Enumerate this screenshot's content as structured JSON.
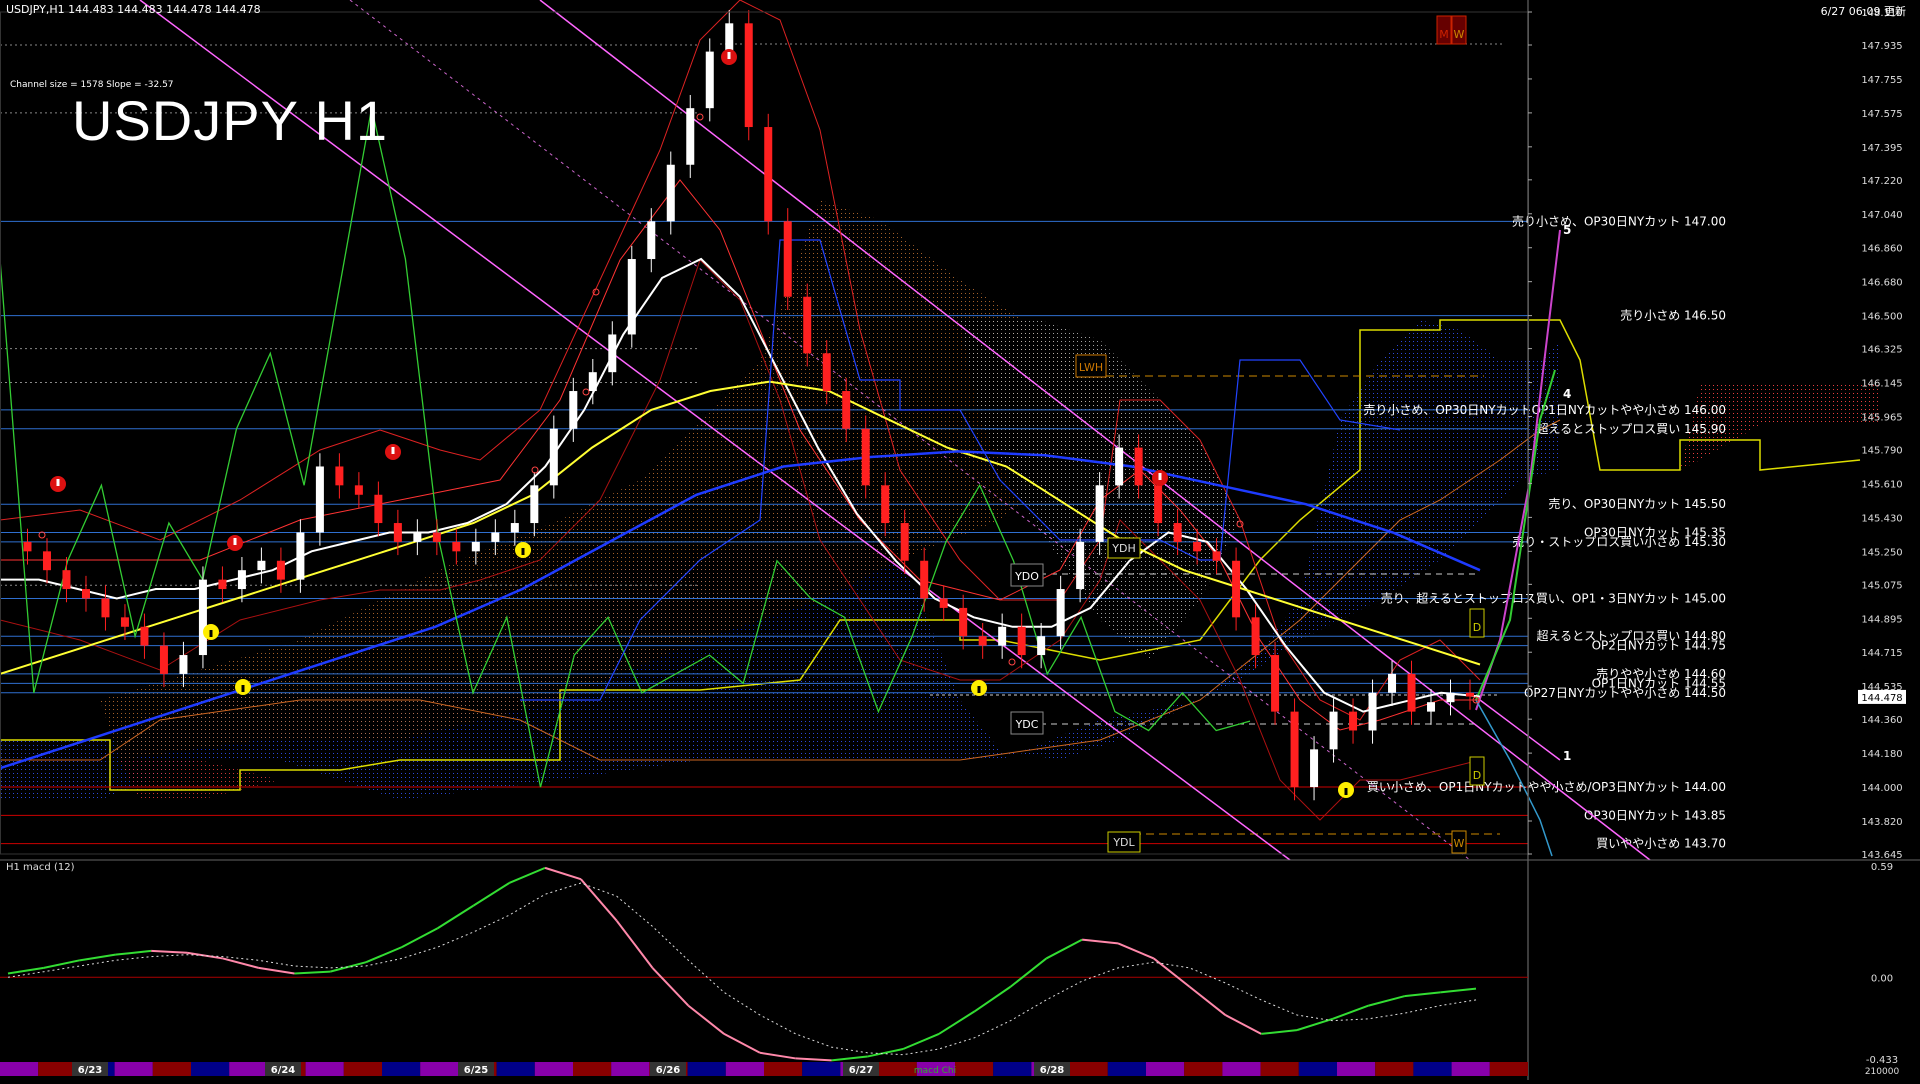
{
  "header": {
    "symbol_line": "USDJPY,H1  144.483 144.483 144.478 144.478",
    "timestamp": "6/27 06:09 更新",
    "channel_info": "Channel size = 1578 Slope = -32.57"
  },
  "watermark": "USDJPY H1",
  "price_axis": {
    "ticks": [
      "148.110",
      "147.935",
      "147.755",
      "147.575",
      "147.395",
      "147.220",
      "147.040",
      "146.860",
      "146.680",
      "146.500",
      "146.325",
      "146.145",
      "145.965",
      "145.790",
      "145.610",
      "145.430",
      "145.250",
      "145.075",
      "144.895",
      "144.715",
      "144.535",
      "144.360",
      "144.180",
      "144.000",
      "143.820",
      "143.645"
    ],
    "current_price": "144.478",
    "range": [
      143.62,
      148.16
    ]
  },
  "macd_panel": {
    "label": "H1  macd (12)",
    "ticks": [
      "0.59",
      "0.00",
      "-0.433"
    ],
    "bottom_label": "210000"
  },
  "date_bar": {
    "labels": [
      "6/23",
      "6/24",
      "6/25",
      "6/26",
      "6/27",
      "6/28"
    ],
    "extra_label": "macd Chi"
  },
  "colors": {
    "background": "#000000",
    "level_line": "#2f6fd0",
    "red_level": "#cc0000",
    "bull_candle": "#ffffff",
    "bear_candle": "#ff2020",
    "sma_white": "#ffffff",
    "sma_yellow": "#ffff33",
    "sma_blue": "#1e3bff",
    "chikou_green": "#33cc33",
    "channel_magenta": "#ff66ff",
    "macd_green": "#33dd33",
    "macd_signal": "#ff88aa"
  },
  "levels": [
    {
      "price": 147.0,
      "text": "売り小さめ、OP30日NYカット 147.00",
      "color": "blue"
    },
    {
      "price": 146.5,
      "text": "売り小さめ 146.50",
      "color": "blue"
    },
    {
      "price": 146.0,
      "text": "売り小さめ、OP30日NYカットOP1日NYカットやや小さめ 146.00",
      "color": "blue"
    },
    {
      "price": 145.9,
      "text": "超えるとストップロス買い 145.90",
      "color": "blue"
    },
    {
      "price": 145.5,
      "text": "売り、OP30日NYカット 145.50",
      "color": "blue"
    },
    {
      "price": 145.35,
      "text": "OP30日NYカット 145.35",
      "color": "blue"
    },
    {
      "price": 145.3,
      "text": "売り・ストップロス買い小さめ 145.30",
      "color": "blue"
    },
    {
      "price": 145.0,
      "text": "売り、超えるとストップロス買い、OP1・3日NYカット 145.00",
      "color": "blue"
    },
    {
      "price": 144.8,
      "text": "超えるとストップロス買い 144.80",
      "color": "blue"
    },
    {
      "price": 144.75,
      "text": "OP2日NYカット 144.75",
      "color": "blue"
    },
    {
      "price": 144.6,
      "text": "売りやや小さめ 144.60",
      "color": "blue"
    },
    {
      "price": 144.55,
      "text": "OP1日NYカット 144.55",
      "color": "blue"
    },
    {
      "price": 144.5,
      "text": "OP27日NYカットやや小さめ 144.50",
      "color": "blue"
    },
    {
      "price": 144.0,
      "text": "買い小さめ、OP1日NYカットやや小さめ/OP3日NYカット 144.00",
      "color": "red"
    },
    {
      "price": 143.85,
      "text": "OP30日NYカット 143.85",
      "color": "red"
    },
    {
      "price": 143.7,
      "text": "買いやや小さめ 143.70",
      "color": "red"
    }
  ],
  "marker_labels": {
    "ydo": "YDO",
    "ydh": "YDH",
    "ydc": "YDC",
    "ydl": "YDL",
    "lwh": "LWH",
    "m": "M",
    "w": "W",
    "d": "D",
    "wave": [
      "1",
      "4",
      "5"
    ]
  },
  "chart_data": {
    "type": "candlestick",
    "title": "USDJPY H1",
    "x_labels": [
      "6/23",
      "6/24",
      "6/25",
      "6/26",
      "6/27",
      "6/28"
    ],
    "ylim": [
      143.645,
      148.11
    ],
    "close_path": [
      145.3,
      145.25,
      145.15,
      145.05,
      145.0,
      144.9,
      144.85,
      144.75,
      144.6,
      144.7,
      145.1,
      145.05,
      145.15,
      145.2,
      145.1,
      145.35,
      145.7,
      145.6,
      145.55,
      145.4,
      145.3,
      145.35,
      145.3,
      145.25,
      145.3,
      145.35,
      145.4,
      145.6,
      145.9,
      146.1,
      146.2,
      146.4,
      146.8,
      147.0,
      147.3,
      147.6,
      147.9,
      148.05,
      147.5,
      147.0,
      146.6,
      146.3,
      146.1,
      145.9,
      145.6,
      145.4,
      145.2,
      145.0,
      144.95,
      144.8,
      144.75,
      144.85,
      144.7,
      144.8,
      145.05,
      145.3,
      145.6,
      145.8,
      145.6,
      145.4,
      145.3,
      145.25,
      145.2,
      144.9,
      144.7,
      144.4,
      144.0,
      144.2,
      144.4,
      144.3,
      144.5,
      144.6,
      144.4,
      144.45,
      144.5,
      144.48
    ],
    "sma_white": [
      145.1,
      145.1,
      145.05,
      145.0,
      145.05,
      145.05,
      145.1,
      145.15,
      145.25,
      145.3,
      145.35,
      145.35,
      145.4,
      145.5,
      145.7,
      146.0,
      146.4,
      146.7,
      146.8,
      146.6,
      146.2,
      145.8,
      145.45,
      145.2,
      145.0,
      144.9,
      144.85,
      144.85,
      144.95,
      145.2,
      145.35,
      145.3,
      145.05,
      144.75,
      144.5,
      144.4,
      144.45,
      144.5,
      144.48
    ],
    "sma_yellow": [
      144.6,
      144.7,
      144.8,
      144.9,
      145.0,
      145.1,
      145.2,
      145.3,
      145.4,
      145.55,
      145.8,
      146.0,
      146.1,
      146.15,
      146.1,
      145.95,
      145.8,
      145.7,
      145.5,
      145.3,
      145.15,
      145.05,
      144.95,
      144.85,
      144.75,
      144.65
    ],
    "sma_blue": [
      144.1,
      144.25,
      144.4,
      144.55,
      144.7,
      144.85,
      145.05,
      145.3,
      145.55,
      145.7,
      145.75,
      145.78,
      145.76,
      145.7,
      145.6,
      145.5,
      145.35,
      145.15
    ],
    "chikou_green": [
      146.8,
      144.5,
      145.2,
      145.6,
      144.8,
      145.4,
      145.1,
      145.9,
      146.3,
      145.6,
      146.6,
      147.6,
      146.8,
      145.3,
      144.5,
      144.9,
      144.0,
      144.7,
      144.9,
      144.5,
      144.6,
      144.7,
      144.55,
      145.2,
      145.0,
      144.9,
      144.4,
      144.8,
      145.3,
      145.6,
      145.2,
      144.6,
      144.9,
      144.4,
      144.3,
      144.5,
      144.3,
      144.35
    ],
    "macd_main": [
      0.02,
      0.05,
      0.09,
      0.12,
      0.14,
      0.13,
      0.1,
      0.05,
      0.02,
      0.03,
      0.08,
      0.16,
      0.26,
      0.38,
      0.5,
      0.58,
      0.52,
      0.3,
      0.05,
      -0.15,
      -0.3,
      -0.4,
      -0.43,
      -0.44,
      -0.42,
      -0.38,
      -0.3,
      -0.18,
      -0.05,
      0.1,
      0.2,
      0.18,
      0.1,
      -0.05,
      -0.2,
      -0.3,
      -0.28,
      -0.22,
      -0.15,
      -0.1,
      -0.08,
      -0.06
    ],
    "macd_signal": [
      0.0,
      0.03,
      0.06,
      0.09,
      0.11,
      0.12,
      0.11,
      0.09,
      0.06,
      0.05,
      0.06,
      0.1,
      0.16,
      0.24,
      0.33,
      0.44,
      0.5,
      0.43,
      0.27,
      0.09,
      -0.08,
      -0.2,
      -0.3,
      -0.37,
      -0.4,
      -0.41,
      -0.38,
      -0.32,
      -0.23,
      -0.12,
      -0.02,
      0.05,
      0.08,
      0.05,
      -0.03,
      -0.12,
      -0.2,
      -0.23,
      -0.22,
      -0.19,
      -0.15,
      -0.12
    ]
  }
}
